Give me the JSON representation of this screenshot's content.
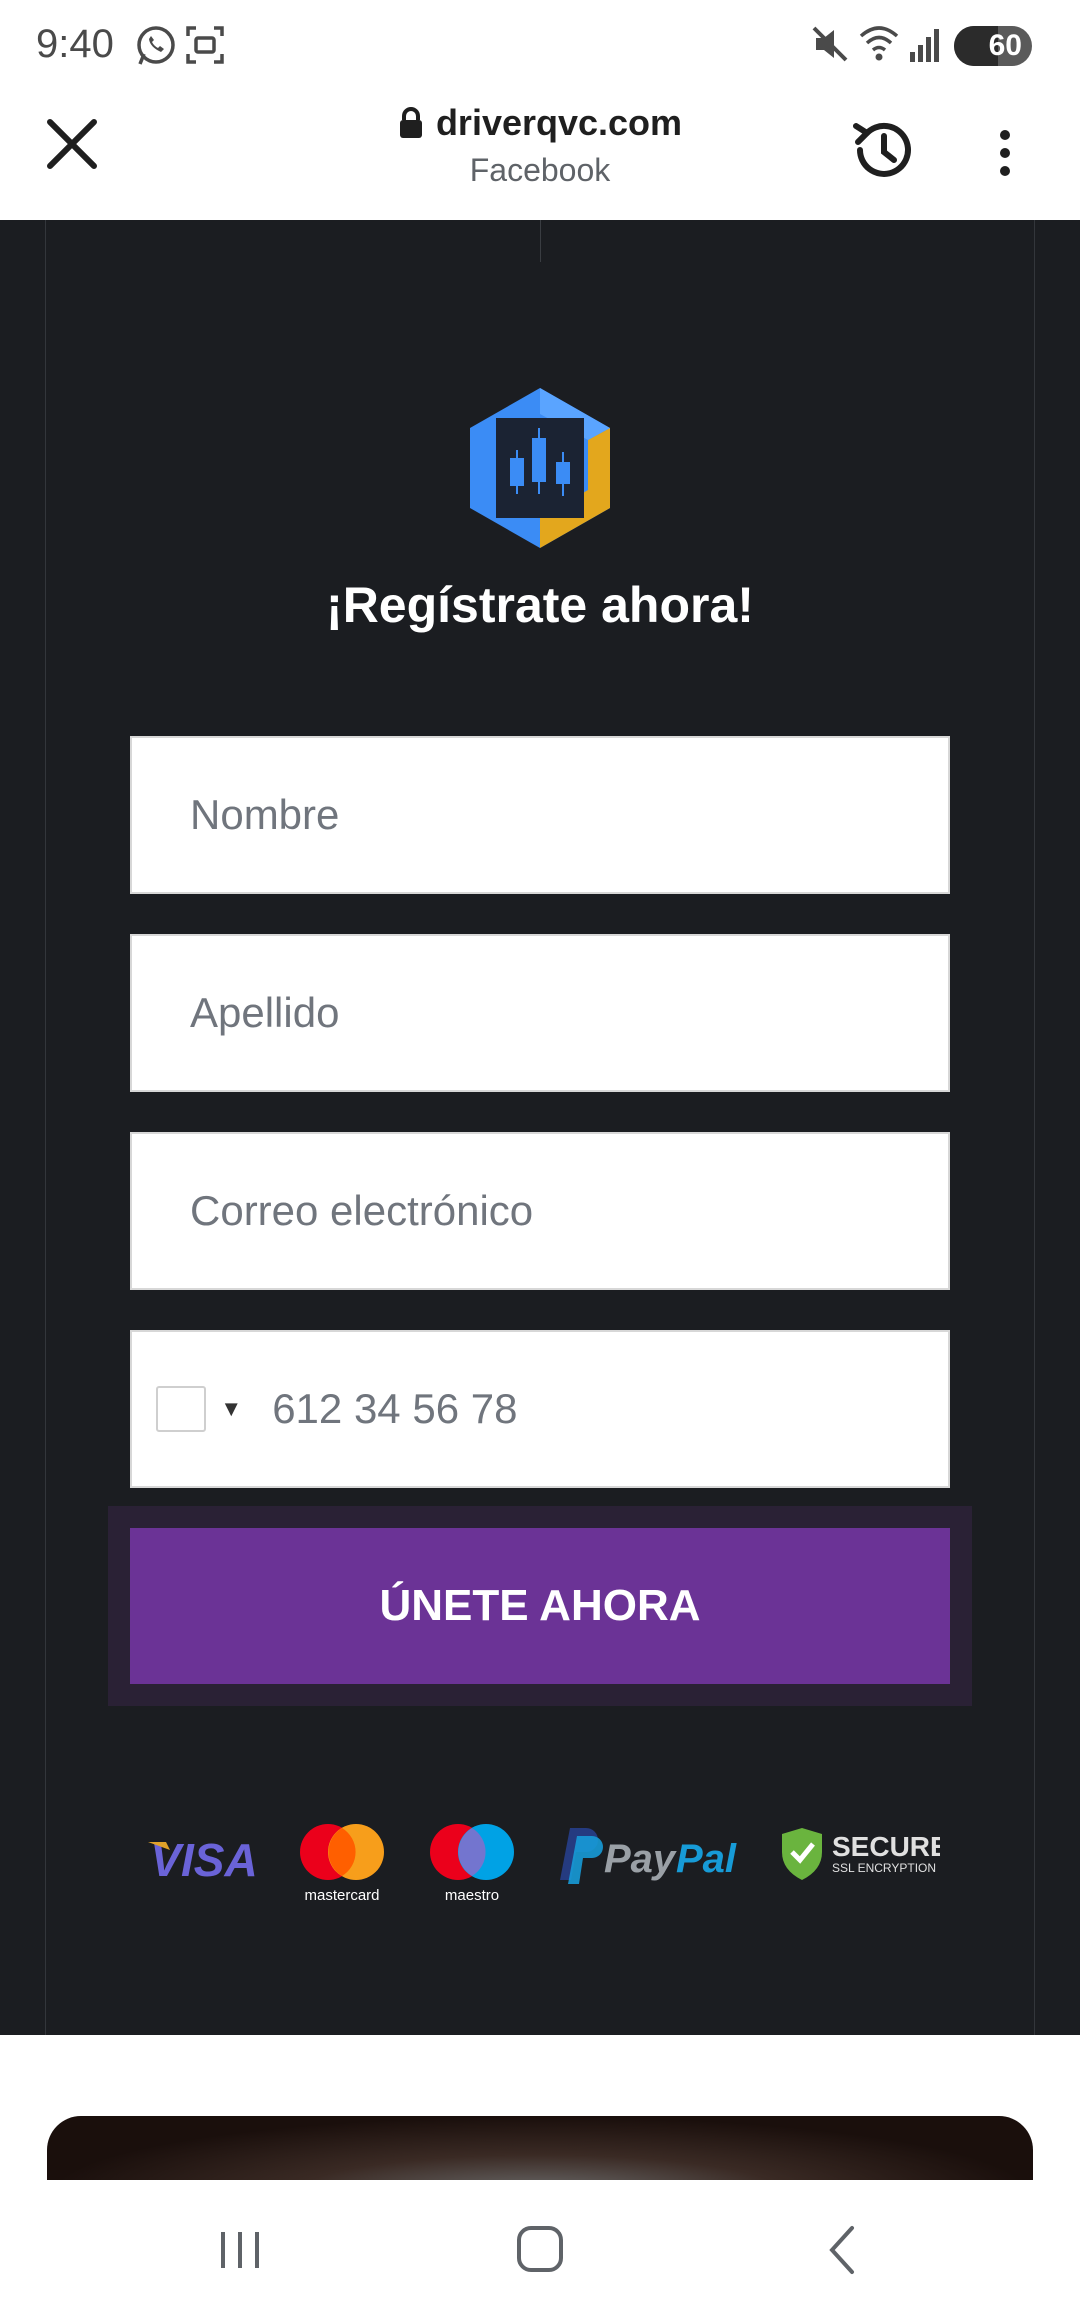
{
  "status_bar": {
    "time": "9:40",
    "battery": "60",
    "icons": [
      "whatsapp-icon",
      "screenshot-icon",
      "mute-icon",
      "wifi-icon",
      "signal-icon",
      "battery-icon"
    ]
  },
  "browser": {
    "url": "driverqvc.com",
    "subtitle": "Facebook"
  },
  "form": {
    "headline": "¡Regístrate ahora!",
    "first_name_placeholder": "Nombre",
    "last_name_placeholder": "Apellido",
    "email_placeholder": "Correo electrónico",
    "phone_placeholder": "612 34 56 78",
    "submit_label": "ÚNETE AHORA"
  },
  "payments": {
    "visa": "VISA",
    "mastercard": "mastercard",
    "maestro": "maestro",
    "paypal_pay": "Pay",
    "paypal_pal": "Pal",
    "secure": "SECURE",
    "secure_sub": "SSL ENCRYPTION"
  },
  "colors": {
    "page_bg": "#1b1d21",
    "cta": "#6b3396",
    "logo_blue": "#3b8cf5",
    "logo_gold": "#e3a71d"
  }
}
